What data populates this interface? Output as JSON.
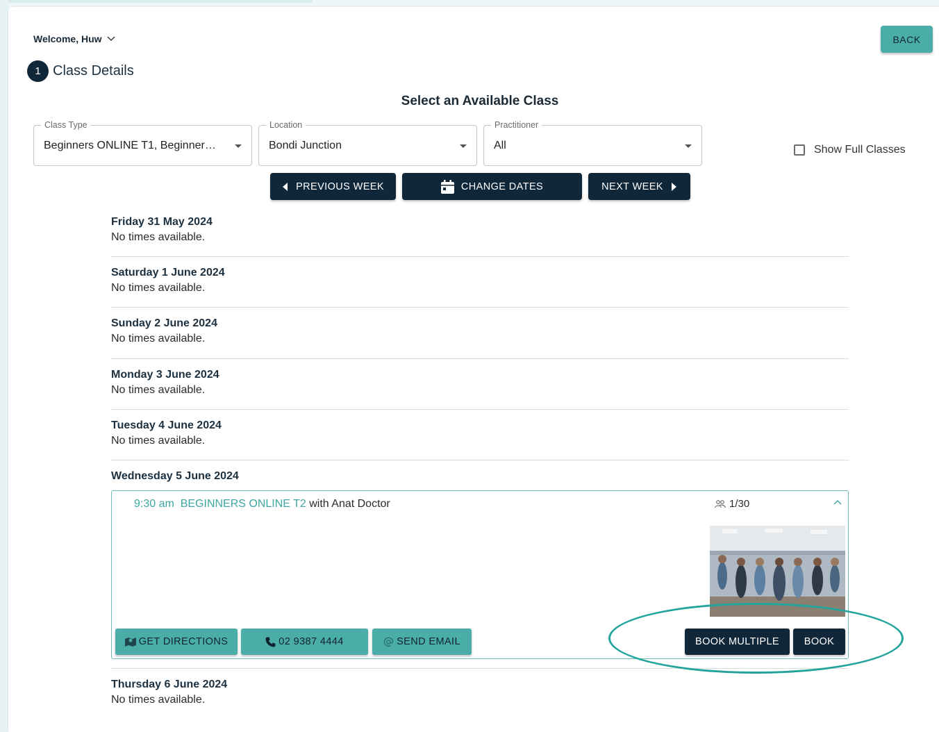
{
  "header": {
    "welcome": "Welcome, Huw",
    "back_label": "BACK",
    "step_number": "1",
    "step_label": "Class Details",
    "heading": "Select an Available Class"
  },
  "filters": {
    "class_type": {
      "label": "Class Type",
      "value": "Beginners ONLINE T1, Beginner…"
    },
    "location": {
      "label": "Location",
      "value": "Bondi Junction"
    },
    "practitioner": {
      "label": "Practitioner",
      "value": "All"
    },
    "show_full_label": "Show Full Classes",
    "show_full_checked": false
  },
  "nav": {
    "prev": "PREVIOUS WEEK",
    "change": "CHANGE DATES",
    "next": "NEXT WEEK"
  },
  "days": [
    {
      "title": "Friday 31 May 2024",
      "msg": "No times available."
    },
    {
      "title": "Saturday 1 June 2024",
      "msg": "No times available."
    },
    {
      "title": "Sunday 2 June 2024",
      "msg": "No times available."
    },
    {
      "title": "Monday 3 June 2024",
      "msg": "No times available."
    },
    {
      "title": "Tuesday 4 June 2024",
      "msg": "No times available."
    },
    {
      "title": "Wednesday 5 June 2024",
      "msg": ""
    },
    {
      "title": "Thursday 6 June 2024",
      "msg": "No times available."
    }
  ],
  "class": {
    "time": "9:30 am",
    "name": "BEGINNERS ONLINE T2",
    "with": "with Anat Doctor",
    "capacity": "1/30",
    "actions": {
      "directions": "GET DIRECTIONS",
      "phone": "02 9387 4444",
      "email": "SEND EMAIL",
      "book_multiple": "BOOK MULTIPLE",
      "book": "BOOK"
    }
  },
  "colors": {
    "primary": "#10273a",
    "accent": "#4aada8",
    "annotation": "#22a39c"
  },
  "icons": [
    "chevron-down-icon",
    "caret-left-icon",
    "calendar-icon",
    "caret-right-icon",
    "people-icon",
    "chevron-up-icon",
    "map-icon",
    "phone-icon",
    "at-icon"
  ]
}
